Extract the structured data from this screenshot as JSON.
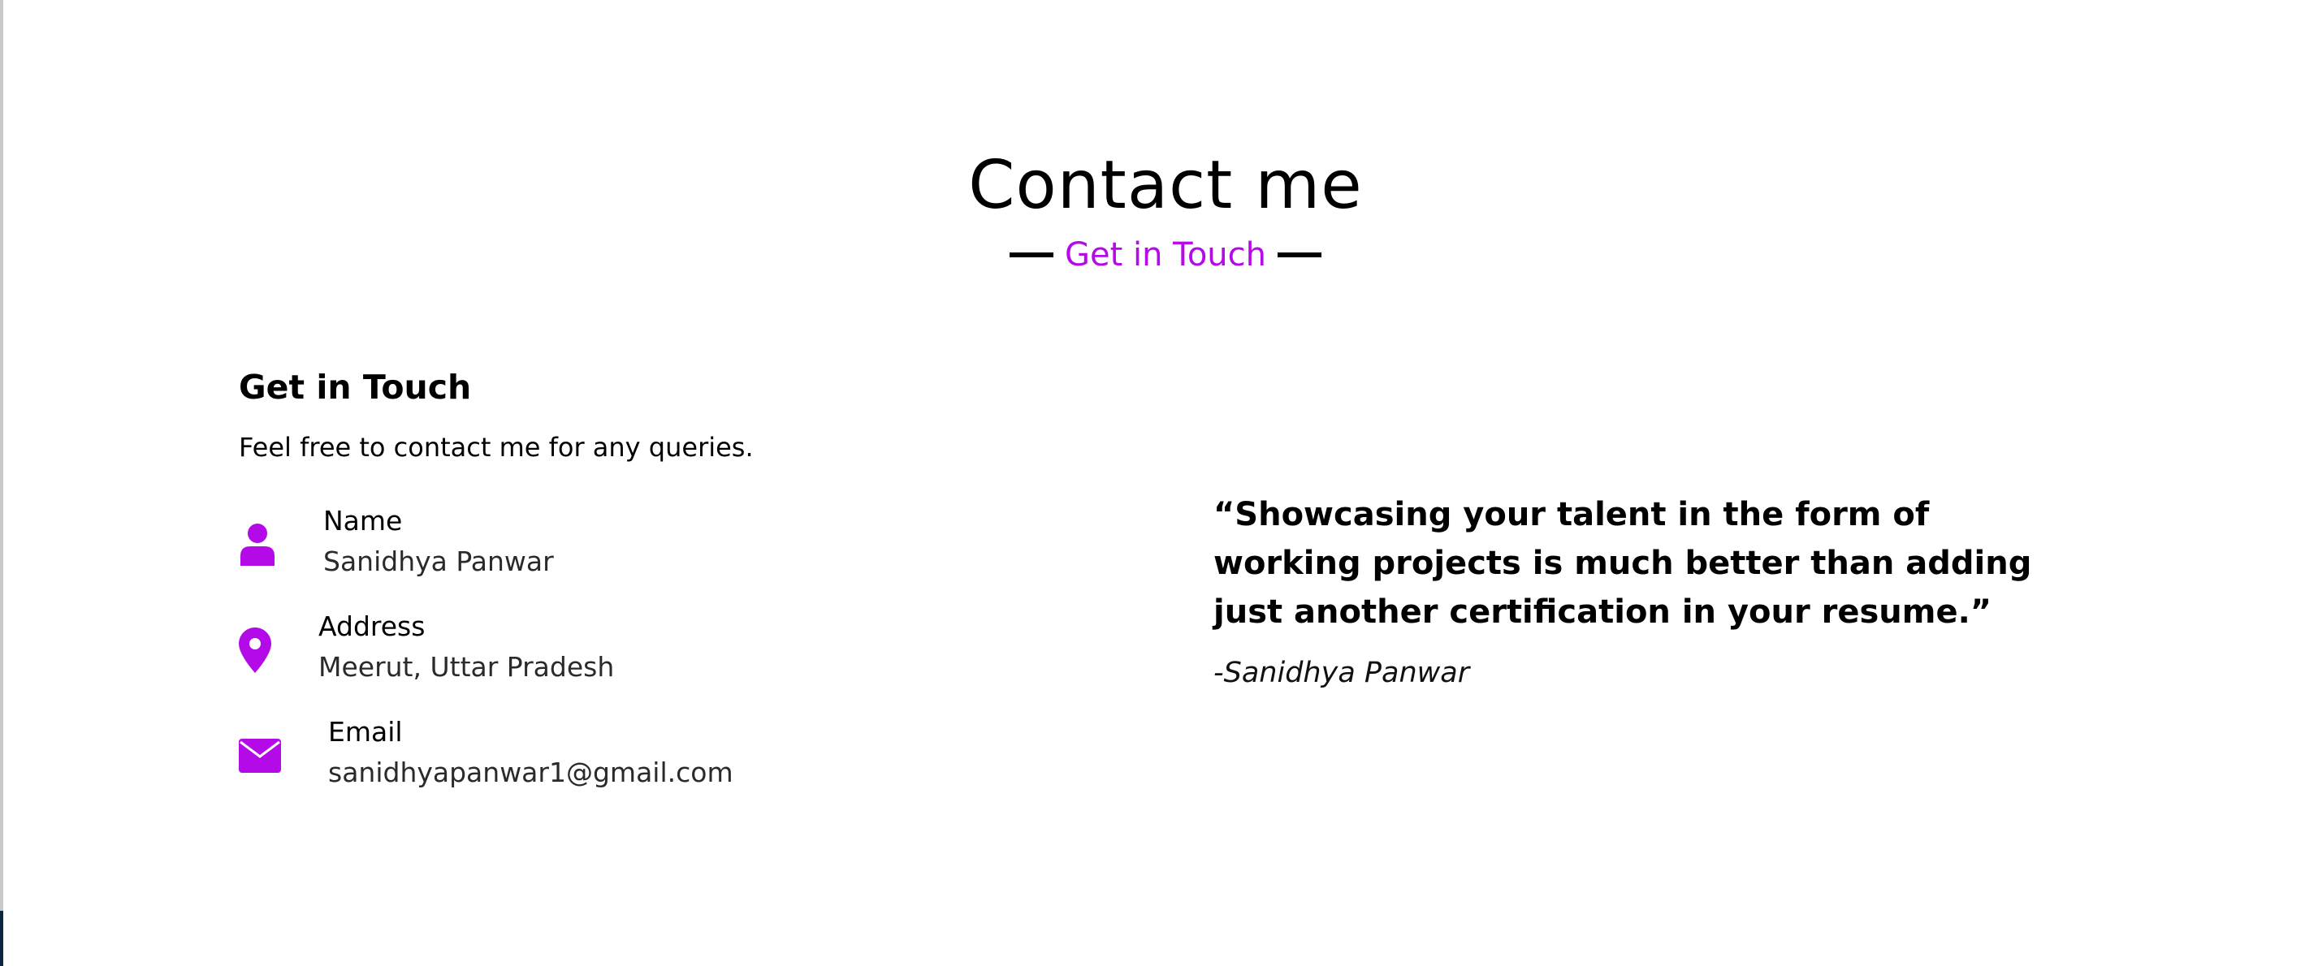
{
  "header": {
    "title": "Contact me",
    "subtitle": "Get in Touch"
  },
  "contact": {
    "heading": "Get in Touch",
    "description": "Feel free to contact me for any queries.",
    "items": [
      {
        "icon": "user-icon",
        "label": "Name",
        "value": "Sanidhya Panwar"
      },
      {
        "icon": "map-pin-icon",
        "label": "Address",
        "value": "Meerut, Uttar Pradesh"
      },
      {
        "icon": "envelope-icon",
        "label": "Email",
        "value": "sanidhyapanwar1@gmail.com"
      }
    ]
  },
  "quote": {
    "text": "“Showcasing your talent in the form of working projects is much better than adding just another certification in your resume.”",
    "author": "-Sanidhya Panwar"
  },
  "colors": {
    "accent": "#b40ae8",
    "text": "#000000"
  }
}
